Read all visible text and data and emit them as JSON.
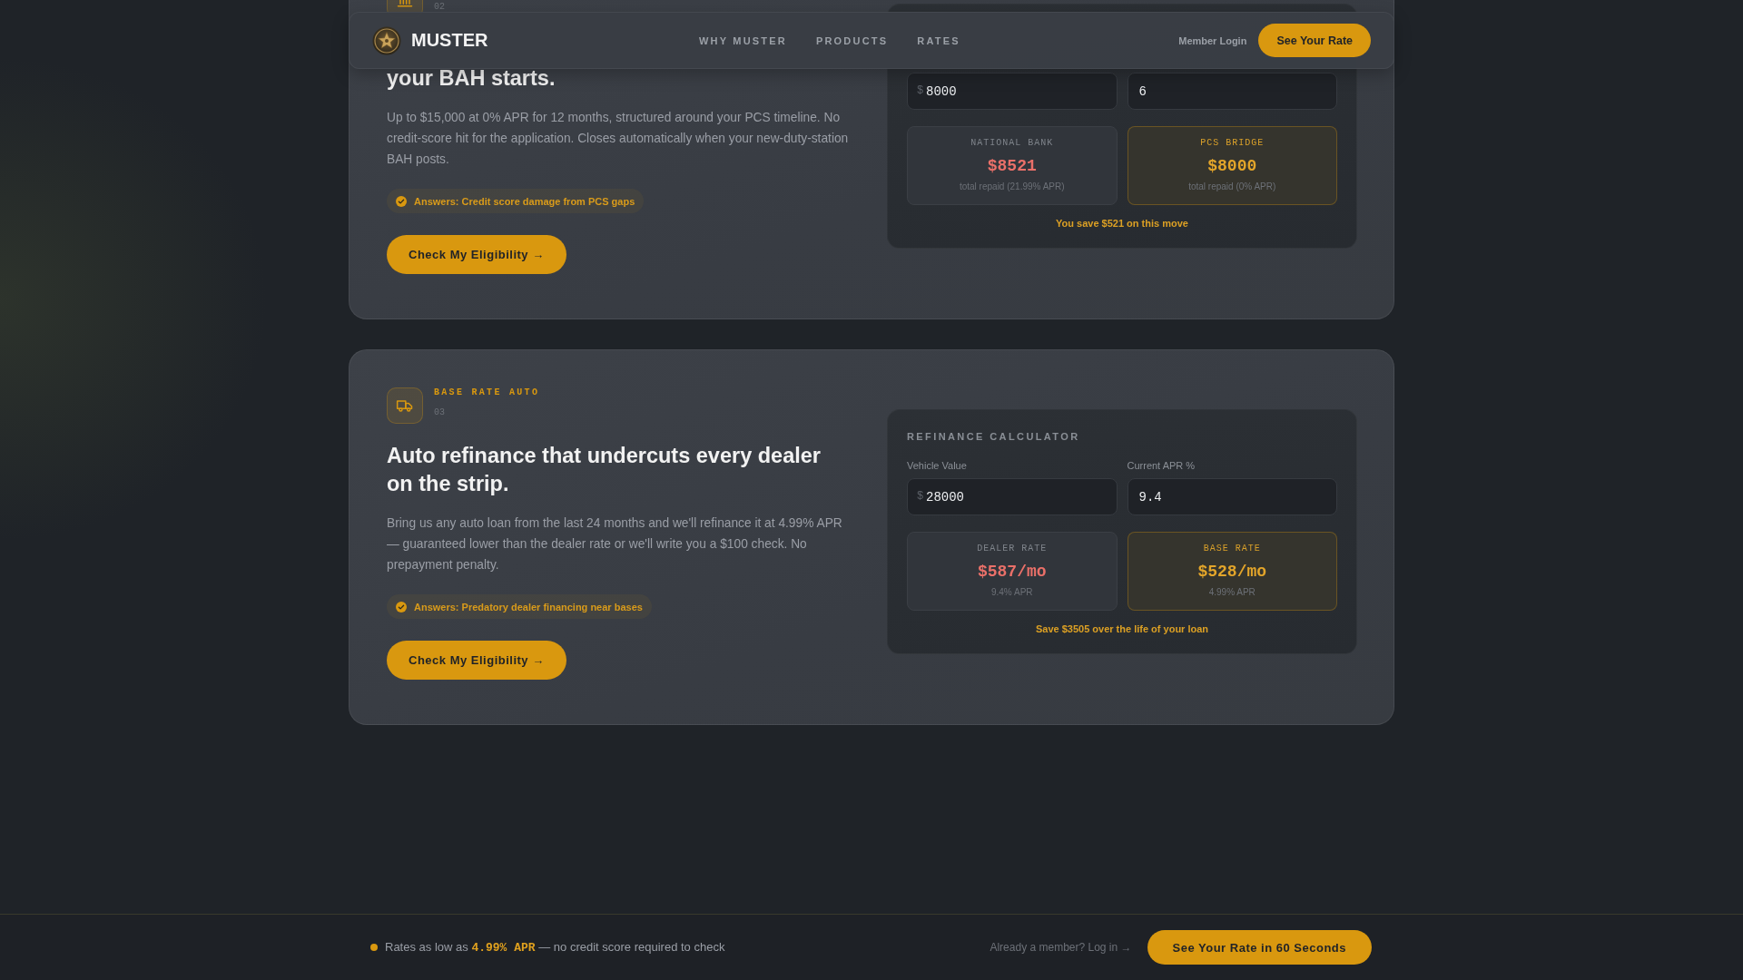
{
  "nav": {
    "brand": "MUSTER",
    "links": [
      "WHY MUSTER",
      "PRODUCTS",
      "RATES"
    ],
    "login": "Member Login",
    "cta": "See Your Rate"
  },
  "products": [
    {
      "kind": "bridge",
      "number": "02",
      "heading": "your BAH starts.",
      "description": "Up to $15,000 at 0% APR for 12 months, structured around your PCS timeline. No credit-score hit for the application. Closes automatically when your new-duty-station BAH posts.",
      "answers": "Answers: Credit score damage from PCS gaps",
      "button": "Check My Eligibility →",
      "calculator": {
        "fields": [
          {
            "prefix": "$",
            "value": "8000"
          },
          {
            "value": "6"
          }
        ],
        "results": [
          {
            "label": "NATIONAL BANK",
            "value": "$8521",
            "note": "total repaid (21.99% APR)",
            "highlighted": false
          },
          {
            "label": "PCS BRIDGE",
            "value": "$8000",
            "note": "total repaid (0% APR)",
            "highlighted": true
          }
        ],
        "savings": "You save $521 on this move"
      }
    },
    {
      "kind": "auto",
      "label": "BASE RATE AUTO",
      "number": "03",
      "heading": "Auto refinance that undercuts every dealer on the strip.",
      "description": "Bring us any auto loan from the last 24 months and we'll refinance it at 4.99% APR — guaranteed lower than the dealer rate or we'll write you a $100 check. No prepayment penalty.",
      "answers": "Answers: Predatory dealer financing near bases",
      "button": "Check My Eligibility →",
      "calculator": {
        "title": "REFINANCE CALCULATOR",
        "fields": [
          {
            "label": "Vehicle Value",
            "prefix": "$",
            "value": "28000"
          },
          {
            "label": "Current APR %",
            "value": "9.4"
          }
        ],
        "results": [
          {
            "label": "DEALER RATE",
            "value": "$587/mo",
            "note": "9.4% APR",
            "highlighted": false
          },
          {
            "label": "BASE RATE",
            "value": "$528/mo",
            "note": "4.99% APR",
            "highlighted": true
          }
        ],
        "savings": "Save $3505 over the life of your loan"
      }
    }
  ],
  "footer_bar": {
    "message": "Rates as low as **4.99% APR** — no credit score required to check",
    "login_link": "Already a member? Log in →",
    "cta": "See Your Rate in 60 Seconds"
  }
}
